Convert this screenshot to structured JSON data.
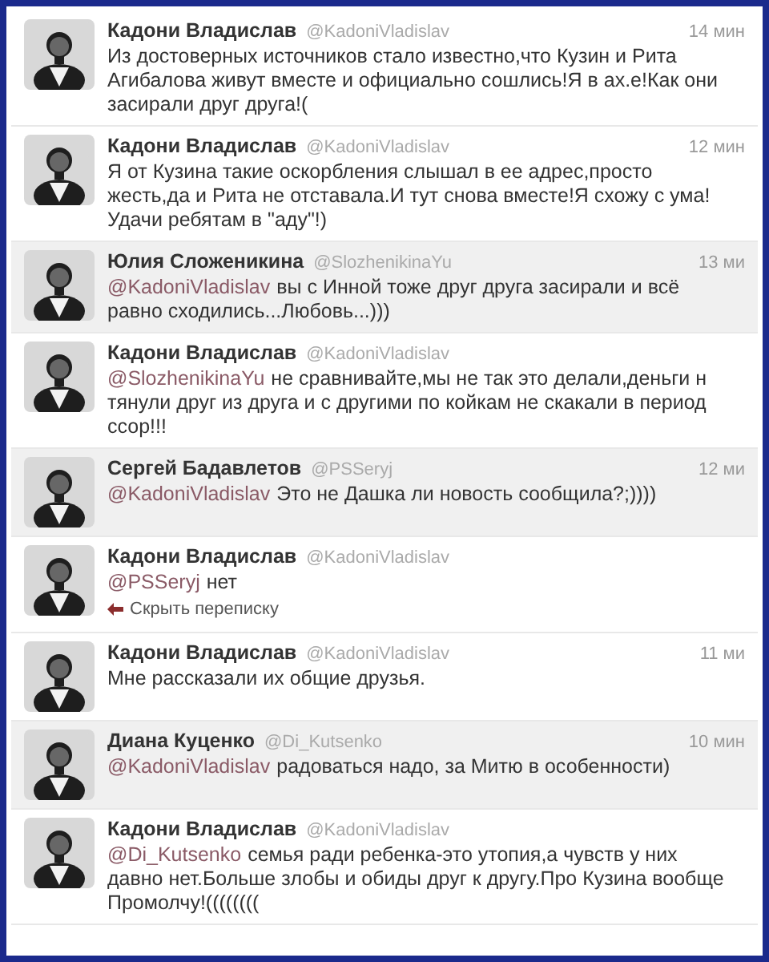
{
  "tweets": [
    {
      "name": "Кадони Владислав",
      "handle": "@KadoniVladislav",
      "time": "14 мин",
      "highlighted": false,
      "lines": [
        "Из достоверных источников стало известно,что Кузин и Рита",
        "Агибалова живут вместе и официально сошлись!Я в ах.е!Как они",
        "засирали друг друга!("
      ]
    },
    {
      "name": "Кадони Владислав",
      "handle": "@KadoniVladislav",
      "time": "12 мин",
      "highlighted": false,
      "lines": [
        "Я от Кузина такие оскорбления слышал в ее адрес,просто",
        "жесть,да и Рита не отставала.И тут снова вместе!Я схожу с ума!",
        "Удачи ребятам в \"аду\"!)"
      ]
    },
    {
      "name": "Юлия Сложеникина",
      "handle": "@SlozhenikinaYu",
      "time": "13 ми",
      "highlighted": true,
      "mention": "@KadoniVladislav",
      "lines": [
        "вы с Инной тоже друг друга засирали и всё",
        "равно сходились...Любовь...)))"
      ]
    },
    {
      "name": "Кадони Владислав",
      "handle": "@KadoniVladislav",
      "highlighted": false,
      "mention": "@SlozhenikinaYu",
      "lines": [
        "не сравнивайте,мы не так это делали,деньги н",
        "тянули друг из друга и с другими по койкам не скакали в период",
        "ссор!!!"
      ]
    },
    {
      "name": "Сергей Бадавлетов",
      "handle": "@PSSeryj",
      "time": "12 ми",
      "highlighted": true,
      "mention": "@KadoniVladislav",
      "lines": [
        "Это не Дашка ли новость сообщила?;))))"
      ]
    },
    {
      "name": "Кадони Владислав",
      "handle": "@KadoniVladislav",
      "highlighted": false,
      "mention": "@PSSeryj",
      "lines": [
        "нет"
      ],
      "reply_link": "Скрыть переписку"
    },
    {
      "name": "Кадони Владислав",
      "handle": "@KadoniVladislav",
      "time": "11 ми",
      "highlighted": false,
      "lines": [
        "Мне рассказали их общие друзья."
      ]
    },
    {
      "name": "Диана Куценко",
      "handle": "@Di_Kutsenko",
      "time": "10 мин",
      "highlighted": true,
      "mention": "@KadoniVladislav",
      "lines": [
        "радоваться надо, за Митю в особенности)"
      ]
    },
    {
      "name": "Кадони Владислав",
      "handle": "@KadoniVladislav",
      "highlighted": false,
      "mention": "@Di_Kutsenko",
      "lines": [
        "семья ради ребенка-это утопия,а чувств у них",
        "давно нет.Больше злобы и обиды друг к другу.Про Кузина вообще",
        "Промолчу!(((((((("
      ]
    }
  ]
}
